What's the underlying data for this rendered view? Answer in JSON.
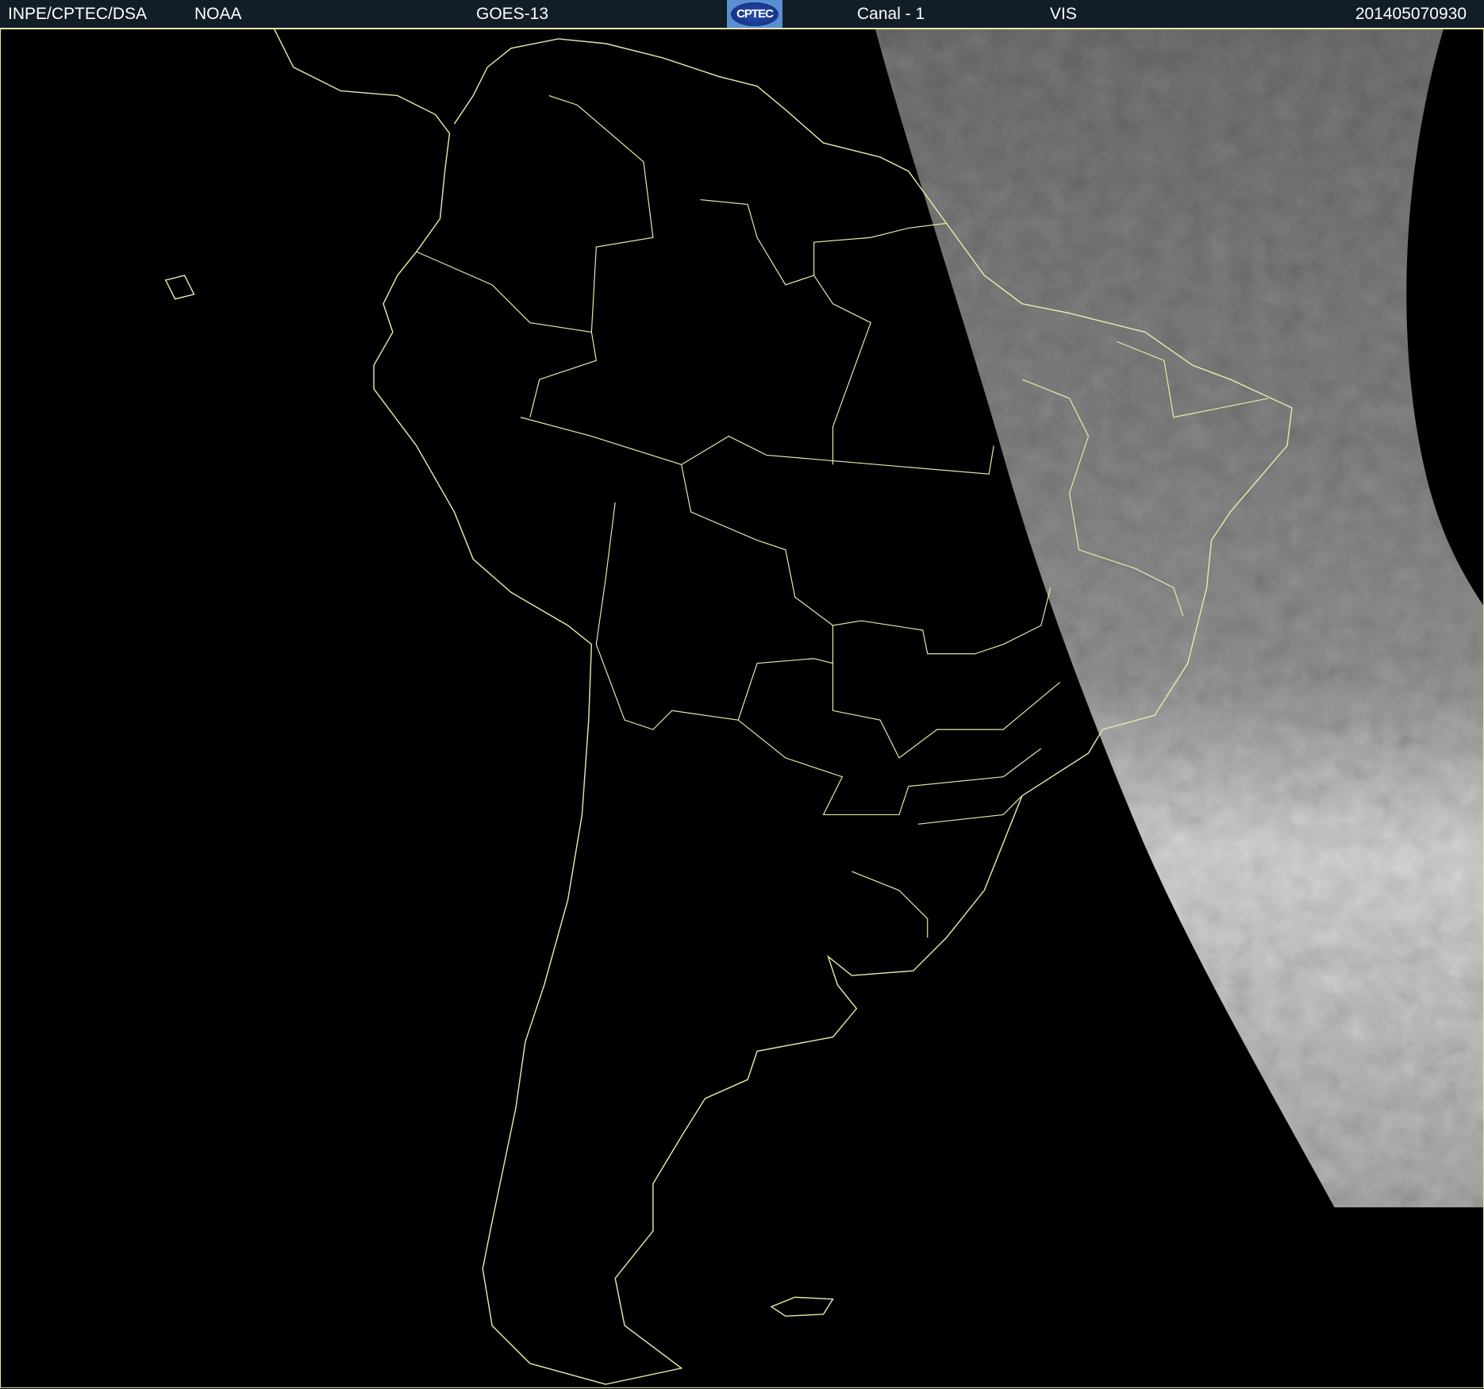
{
  "header": {
    "institution": "INPE/CPTEC/DSA",
    "agency": "NOAA",
    "satellite": "GOES-13",
    "logo_text": "CPTEC",
    "channel": "Canal - 1",
    "band": "VIS",
    "timestamp": "201405070930"
  },
  "colors": {
    "header_bg": "#111d27",
    "coastline": "#e8e8a8",
    "background": "#000000"
  }
}
